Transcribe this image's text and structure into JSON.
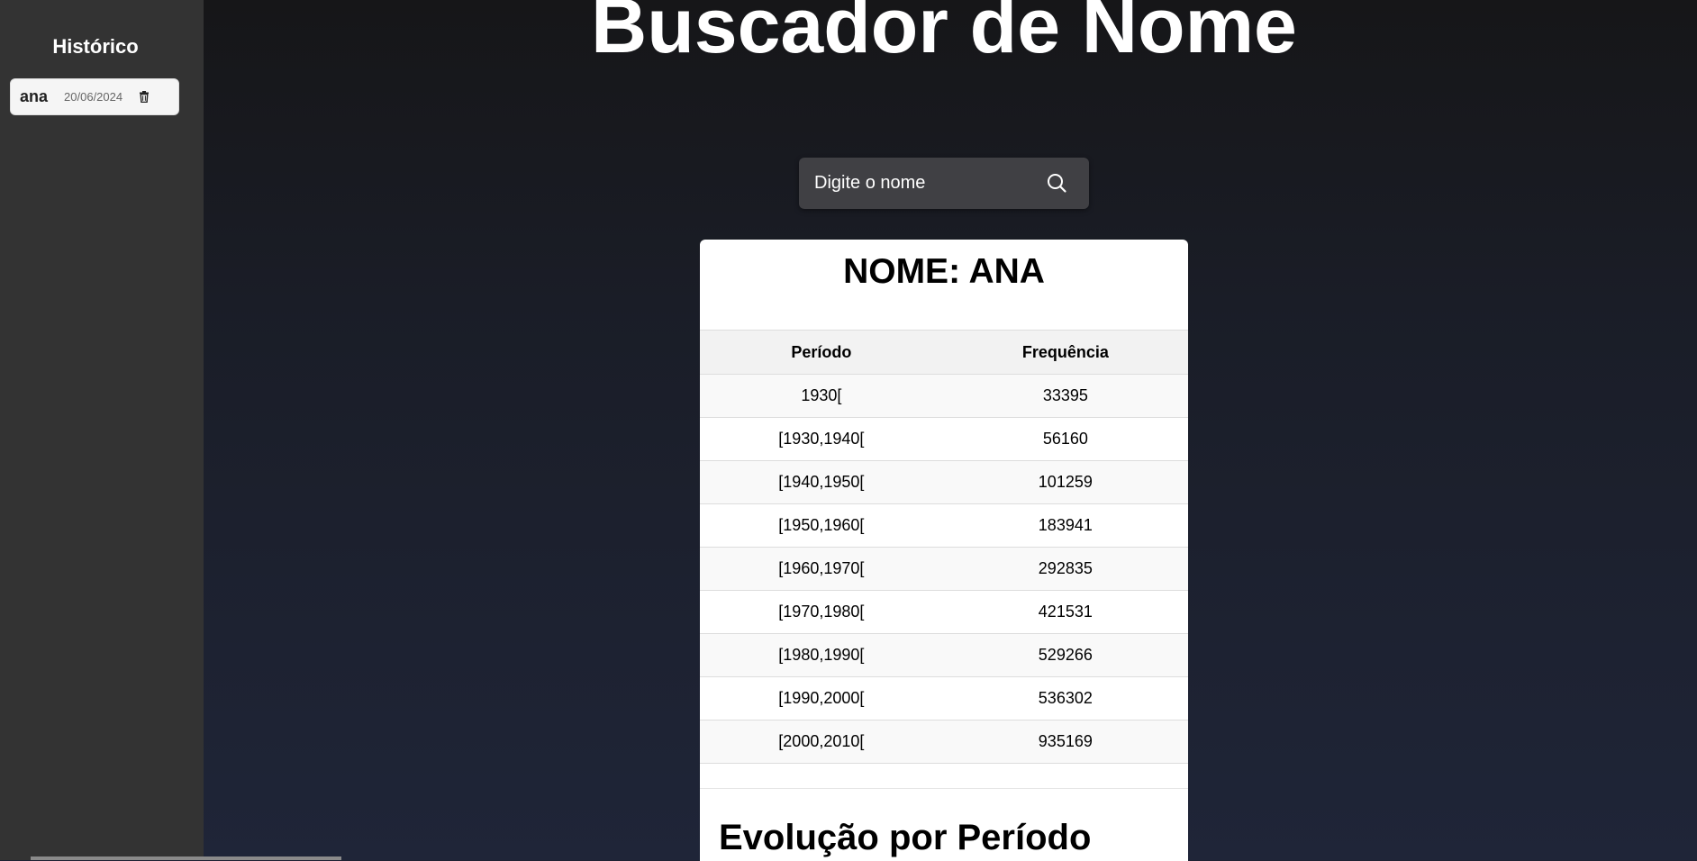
{
  "sidebar": {
    "title": "Histórico",
    "history": [
      {
        "name": "ana",
        "date": "20/06/2024"
      }
    ]
  },
  "header": {
    "title": "Buscador de Nome"
  },
  "search": {
    "placeholder": "Digite o nome",
    "value": ""
  },
  "result": {
    "title": "NOME: ANA",
    "columns": [
      "Período",
      "Frequência"
    ],
    "rows": [
      {
        "period": "1930[",
        "frequency": "33395"
      },
      {
        "period": "[1930,1940[",
        "frequency": "56160"
      },
      {
        "period": "[1940,1950[",
        "frequency": "101259"
      },
      {
        "period": "[1950,1960[",
        "frequency": "183941"
      },
      {
        "period": "[1960,1970[",
        "frequency": "292835"
      },
      {
        "period": "[1970,1980[",
        "frequency": "421531"
      },
      {
        "period": "[1980,1990[",
        "frequency": "529266"
      },
      {
        "period": "[1990,2000[",
        "frequency": "536302"
      },
      {
        "period": "[2000,2010[",
        "frequency": "935169"
      }
    ]
  },
  "chart_section": {
    "title": "Evolução por Período"
  },
  "colors": {
    "sidebar_bg": "#333333",
    "main_bg_top": "#161618",
    "main_bg_bottom": "#1f2538",
    "search_bg": "#404044",
    "card_bg": "#ffffff"
  },
  "icons": {
    "search": "search-icon",
    "delete": "trash-icon"
  }
}
